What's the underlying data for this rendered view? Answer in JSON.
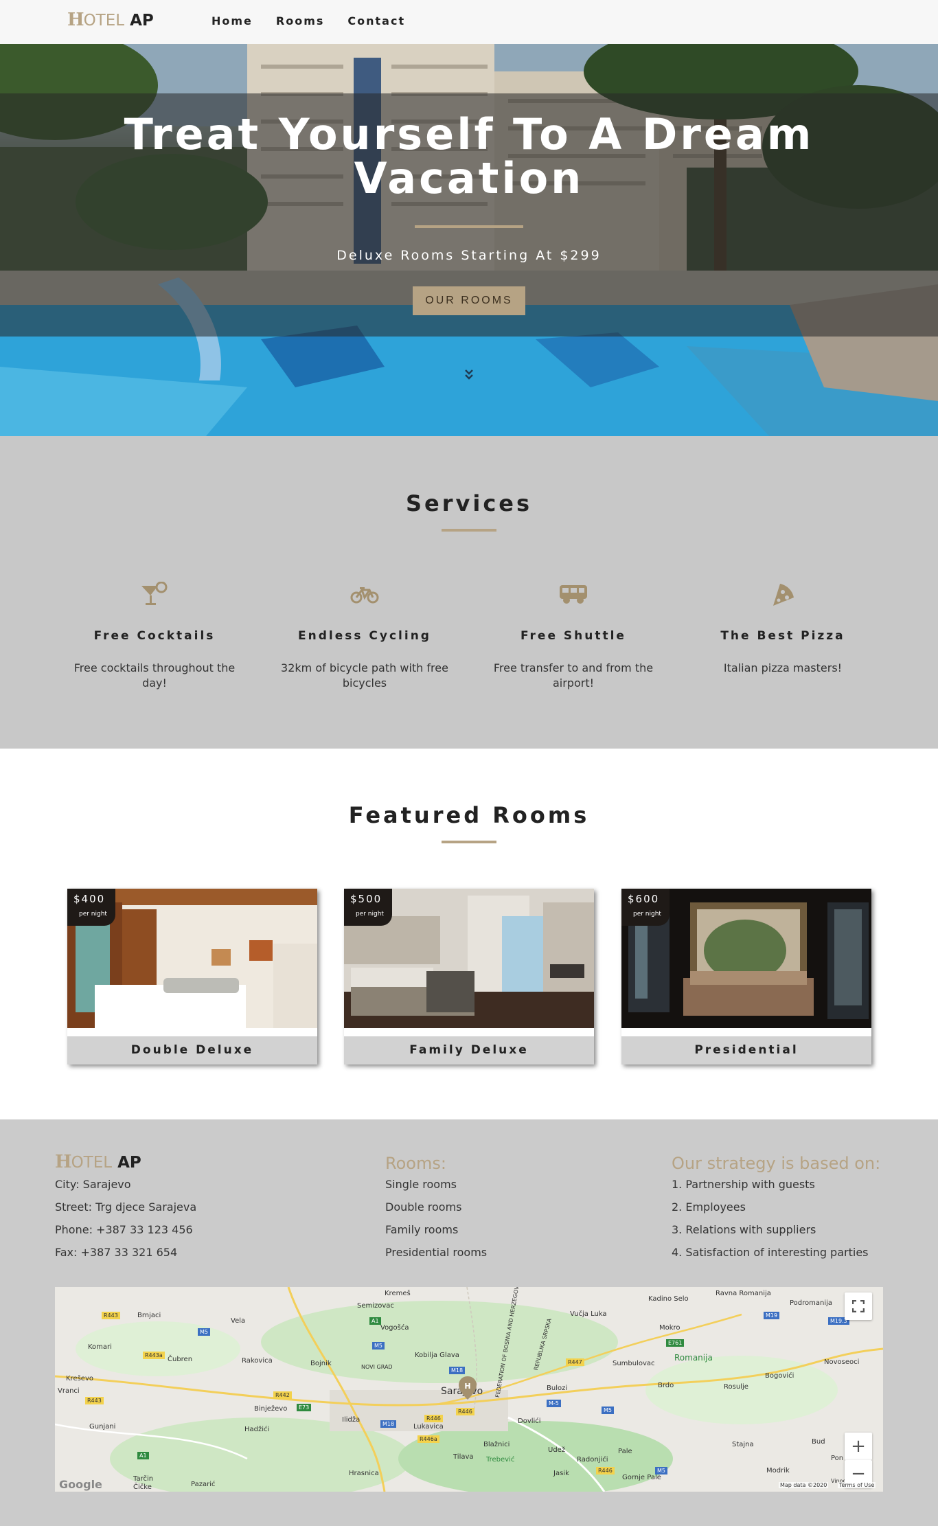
{
  "brand": {
    "logo_h": "H",
    "logo_otel": "OTEL",
    "logo_ap": "AP"
  },
  "nav": {
    "items": [
      {
        "label": "Home"
      },
      {
        "label": "Rooms"
      },
      {
        "label": "Contact"
      }
    ]
  },
  "hero": {
    "title_line1": "Treat Yourself To A Dream",
    "title_line2": "Vacation",
    "subtitle": "Deluxe Rooms Starting At $299",
    "button_label": "OUR ROOMS",
    "scroll_icon": "double-chevron-down-icon"
  },
  "services": {
    "title": "Services",
    "items": [
      {
        "icon": "cocktail-icon",
        "title": "Free Cocktails",
        "desc": "Free cocktails throughout the day!"
      },
      {
        "icon": "bicycle-icon",
        "title": "Endless Cycling",
        "desc": "32km of bicycle path with free bicycles"
      },
      {
        "icon": "shuttle-icon",
        "title": "Free Shuttle",
        "desc": "Free transfer to and from the airport!"
      },
      {
        "icon": "pizza-icon",
        "title": "The Best Pizza",
        "desc": "Italian pizza masters!"
      }
    ]
  },
  "featured": {
    "title": "Featured Rooms",
    "rooms": [
      {
        "price": "$400",
        "per": "per night",
        "name": "Double Deluxe"
      },
      {
        "price": "$500",
        "per": "per night",
        "name": "Family Deluxe"
      },
      {
        "price": "$600",
        "per": "per night",
        "name": "Presidential"
      }
    ]
  },
  "footer": {
    "contact": [
      "City: Sarajevo",
      "Street: Trg djece Sarajeva",
      "Phone: +387 33 123 456",
      "Fax: +387 33 321 654"
    ],
    "rooms_title": "Rooms:",
    "rooms": [
      "Single rooms",
      "Double rooms",
      "Family rooms",
      "Presidential rooms"
    ],
    "strategy_title": "Our strategy is based on:",
    "strategy": [
      "1. Partnership with guests",
      "2. Employees",
      "3. Relations with suppliers",
      "4. Satisfaction of interesting parties"
    ]
  },
  "map": {
    "places": [
      "Kreševo",
      "Vranci",
      "Gunjani",
      "Komari",
      "Brnjaci",
      "Vela",
      "Čubren",
      "Rakovica",
      "Bojnik",
      "Binježevo",
      "Hadžići",
      "Ilidža",
      "Tarčin",
      "Čičke",
      "Pazarić",
      "Hrasnica",
      "Semizovac",
      "Vogošća",
      "Kremeš",
      "Kobilja Glava",
      "NOVI GRAD",
      "Sarajevo",
      "Lukavica",
      "Tilava",
      "Blažnici",
      "Trebević",
      "Jasik",
      "Dovlići",
      "Radonjići",
      "Gornje Pale",
      "Pale",
      "Udež",
      "Bulozi",
      "Brdo",
      "Rosulje",
      "Sumbulovac",
      "Vučja Luka",
      "Kadino Selo",
      "Ravna Romanija",
      "Podromanija",
      "Mokro",
      "Romanija",
      "Bogovići",
      "Novoseoci",
      "Stajna",
      "Bud",
      "Modrik",
      "Pon",
      "Vinograd",
      "FEDERATION OF BOSNIA AND HERZEGOVINA",
      "REPUBLIKA SRPSKA"
    ],
    "roads": [
      "R443",
      "R443a",
      "R442",
      "R443",
      "A1",
      "M5",
      "E73",
      "M18",
      "M5",
      "M18",
      "R446",
      "R446",
      "R446a",
      "M-5",
      "M5",
      "R447",
      "M19",
      "E761",
      "M19.3",
      "R446",
      "M5",
      "A1"
    ],
    "google": "Google",
    "attribution": "Map data ©2020",
    "terms": "Terms of Use",
    "zoom_in": "+",
    "zoom_out": "−",
    "fullscreen_icon": "fullscreen-icon"
  }
}
